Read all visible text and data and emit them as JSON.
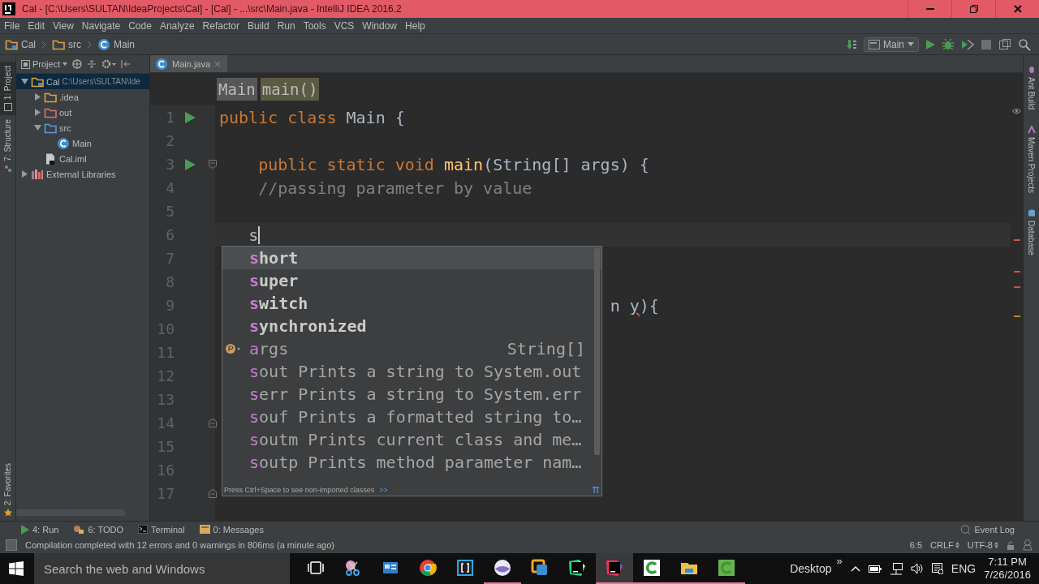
{
  "window": {
    "title": "Cal - [C:\\Users\\SULTAN\\IdeaProjects\\Cal] - [Cal] - ...\\src\\Main.java - IntelliJ IDEA 2016.2"
  },
  "menu": [
    "File",
    "Edit",
    "View",
    "Navigate",
    "Code",
    "Analyze",
    "Refactor",
    "Build",
    "Run",
    "Tools",
    "VCS",
    "Window",
    "Help"
  ],
  "nav_bar": {
    "breadcrumbs": [
      {
        "label": "Cal",
        "kind": "project"
      },
      {
        "label": "src",
        "kind": "folder"
      },
      {
        "label": "Main",
        "kind": "class"
      }
    ],
    "run_config": "Main"
  },
  "left_stripe": {
    "top": [
      {
        "label": "1: Project",
        "kind": "project",
        "selected": true
      },
      {
        "label": "7: Structure",
        "kind": "structure",
        "selected": false
      }
    ],
    "bottom": [
      {
        "label": "2: Favorites",
        "kind": "favorites",
        "selected": false
      }
    ]
  },
  "right_stripe": [
    {
      "label": "Ant Build",
      "kind": "ant"
    },
    {
      "label": "Maven Projects",
      "kind": "maven"
    },
    {
      "label": "Database",
      "kind": "database"
    }
  ],
  "project_panel": {
    "title": "Project",
    "tree": [
      {
        "label": "Cal",
        "path": "C:\\Users\\SULTAN\\Ide",
        "kind": "module",
        "expanded": true,
        "selected": true,
        "children": [
          {
            "label": ".idea",
            "kind": "folder",
            "expanded": false,
            "selected": false
          },
          {
            "label": "out",
            "kind": "excluded",
            "expanded": false,
            "selected": false
          },
          {
            "label": "src",
            "kind": "source",
            "expanded": true,
            "selected": false,
            "children": [
              {
                "label": "Main",
                "kind": "class",
                "selected": false
              }
            ]
          },
          {
            "label": "Cal.iml",
            "kind": "file",
            "selected": false
          }
        ]
      },
      {
        "label": "External Libraries",
        "kind": "library",
        "expanded": false,
        "selected": false
      }
    ]
  },
  "editor": {
    "tabs": [
      {
        "label": "Main.java",
        "selected": true
      }
    ],
    "breadcrumbs": [
      {
        "label": "Main",
        "kind": "class"
      },
      {
        "label": "main()",
        "kind": "method"
      }
    ],
    "lines": [
      {
        "number": "1",
        "run": true,
        "fold_start": false,
        "fold_end": false,
        "current": false,
        "tokens": [
          {
            "text": "public class",
            "kind": "keyword"
          },
          {
            "text": " Main {",
            "kind": "plain"
          }
        ]
      },
      {
        "number": "2",
        "run": false,
        "fold_start": false,
        "fold_end": false,
        "current": false
      },
      {
        "number": "3",
        "run": true,
        "fold_start": true,
        "fold_end": false,
        "current": false,
        "tokens": [
          {
            "text": "    public static void ",
            "kind": "keyword"
          },
          {
            "text": "main",
            "kind": "method"
          },
          {
            "text": "(String[] args) {",
            "kind": "plain"
          }
        ]
      },
      {
        "number": "4",
        "run": false,
        "fold_start": false,
        "fold_end": false,
        "current": false,
        "tokens": [
          {
            "text": "    //passing parameter by value",
            "kind": "comment"
          }
        ]
      },
      {
        "number": "5",
        "run": false,
        "fold_start": false,
        "fold_end": false,
        "current": false
      },
      {
        "number": "6",
        "run": false,
        "fold_start": false,
        "fold_end": false,
        "current": true,
        "tokens": [
          {
            "text": "   s",
            "kind": "plain"
          }
        ]
      },
      {
        "number": "7",
        "run": false,
        "fold_start": false,
        "fold_end": false,
        "current": false
      },
      {
        "number": "8",
        "run": false,
        "fold_start": false,
        "fold_end": false,
        "current": false
      },
      {
        "number": "9",
        "run": false,
        "fold_start": false,
        "fold_end": false,
        "current": false,
        "tokens": [
          {
            "text": "                                        n ",
            "kind": "plain"
          },
          {
            "text": "y",
            "kind": "error"
          },
          {
            "text": "){",
            "kind": "plain"
          }
        ]
      },
      {
        "number": "10",
        "run": false,
        "fold_start": false,
        "fold_end": false,
        "current": false
      },
      {
        "number": "11",
        "run": false,
        "fold_start": false,
        "fold_end": false,
        "current": false
      },
      {
        "number": "12",
        "run": false,
        "fold_start": false,
        "fold_end": false,
        "current": false
      },
      {
        "number": "13",
        "run": false,
        "fold_start": false,
        "fold_end": false,
        "current": false
      },
      {
        "number": "14",
        "run": false,
        "fold_start": false,
        "fold_end": true,
        "current": false
      },
      {
        "number": "15",
        "run": false,
        "fold_start": false,
        "fold_end": false,
        "current": false
      },
      {
        "number": "16",
        "run": false,
        "fold_start": false,
        "fold_end": false,
        "current": false
      },
      {
        "number": "17",
        "run": false,
        "fold_start": false,
        "fold_end": true,
        "current": false
      }
    ],
    "completion": {
      "items": [
        {
          "kind": "keyword",
          "name": "short",
          "selected": true
        },
        {
          "kind": "keyword",
          "name": "super",
          "selected": false
        },
        {
          "kind": "keyword",
          "name": "switch",
          "selected": false
        },
        {
          "kind": "keyword",
          "name": "synchronized",
          "selected": false
        },
        {
          "kind": "parameter",
          "name": "args",
          "type": "String[]",
          "selected": false
        },
        {
          "kind": "template",
          "name": "sout",
          "description": "Prints a string to System.out",
          "selected": false
        },
        {
          "kind": "template",
          "name": "serr",
          "description": "Prints a string to System.err",
          "selected": false
        },
        {
          "kind": "template",
          "name": "souf",
          "description": "Prints a formatted string to…",
          "selected": false
        },
        {
          "kind": "template",
          "name": "soutm",
          "description": "Prints current class and me…",
          "selected": false
        },
        {
          "kind": "template",
          "name": "soutp",
          "description": "Prints method parameter nam…",
          "selected": false
        }
      ],
      "hint": "Press Ctrl+Space to see non-imported classes",
      "hint_link": ">>"
    }
  },
  "tool_windows": [
    {
      "label": "4: Run",
      "kind": "run"
    },
    {
      "label": "6: TODO",
      "kind": "todo"
    },
    {
      "label": "Terminal",
      "kind": "terminal"
    },
    {
      "label": "0: Messages",
      "kind": "messages"
    }
  ],
  "event_log": "Event Log",
  "status_bar": {
    "message": "Compilation completed with 12 errors and 0 warnings in 806ms (a minute ago)",
    "position": "6:5",
    "line_separator": "CRLF",
    "encoding": "UTF-8"
  },
  "taskbar": {
    "search": {
      "placeholder": "Search the web and Windows"
    },
    "apps": [
      {
        "kind": "task-view",
        "running": false,
        "selected": false
      },
      {
        "kind": "snipping",
        "running": false,
        "selected": false
      },
      {
        "kind": "blue-window",
        "running": false,
        "selected": false
      },
      {
        "kind": "chrome",
        "running": false,
        "selected": false
      },
      {
        "kind": "brackets",
        "running": false,
        "selected": false
      },
      {
        "kind": "sphere",
        "running": true,
        "selected": false
      },
      {
        "kind": "vmware",
        "running": false,
        "selected": false
      },
      {
        "kind": "pycharm",
        "running": false,
        "selected": false
      },
      {
        "kind": "intellij",
        "running": true,
        "selected": true
      },
      {
        "kind": "camtasia",
        "running": true,
        "selected": false
      },
      {
        "kind": "explorer",
        "running": true,
        "selected": false
      },
      {
        "kind": "camtasia",
        "running": true,
        "selected": false
      }
    ],
    "desktop": "Desktop",
    "overflow": "»",
    "language": "ENG",
    "time": "7:11 PM",
    "date": "7/26/2016"
  }
}
